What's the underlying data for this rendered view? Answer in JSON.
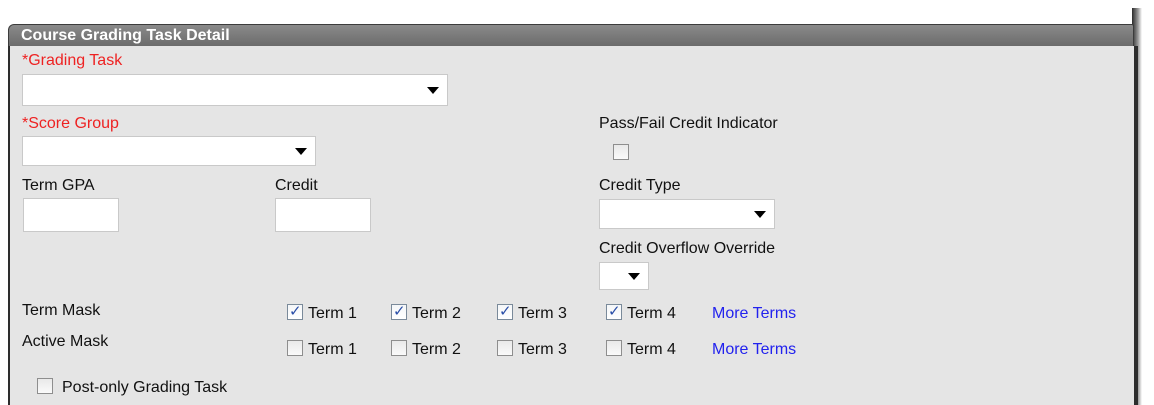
{
  "panel": {
    "title": "Course Grading Task Detail"
  },
  "grading_task": {
    "label": "*Grading Task",
    "value": ""
  },
  "score_group": {
    "label": "*Score Group",
    "value": ""
  },
  "pass_fail": {
    "label": "Pass/Fail Credit Indicator",
    "checked": false
  },
  "term_gpa": {
    "label": "Term GPA",
    "value": ""
  },
  "credit": {
    "label": "Credit",
    "value": ""
  },
  "credit_type": {
    "label": "Credit Type",
    "value": ""
  },
  "credit_overflow": {
    "label": "Credit Overflow Override",
    "value": ""
  },
  "term_mask": {
    "label": "Term Mask",
    "terms": [
      {
        "label": "Term 1",
        "checked": true
      },
      {
        "label": "Term 2",
        "checked": true
      },
      {
        "label": "Term 3",
        "checked": true
      },
      {
        "label": "Term 4",
        "checked": true
      }
    ],
    "more_link": "More Terms"
  },
  "active_mask": {
    "label": "Active Mask",
    "terms": [
      {
        "label": "Term 1",
        "checked": false
      },
      {
        "label": "Term 2",
        "checked": false
      },
      {
        "label": "Term 3",
        "checked": false
      },
      {
        "label": "Term 4",
        "checked": false
      }
    ],
    "more_link": "More Terms"
  },
  "post_only": {
    "label": "Post-only Grading Task",
    "checked": false
  }
}
